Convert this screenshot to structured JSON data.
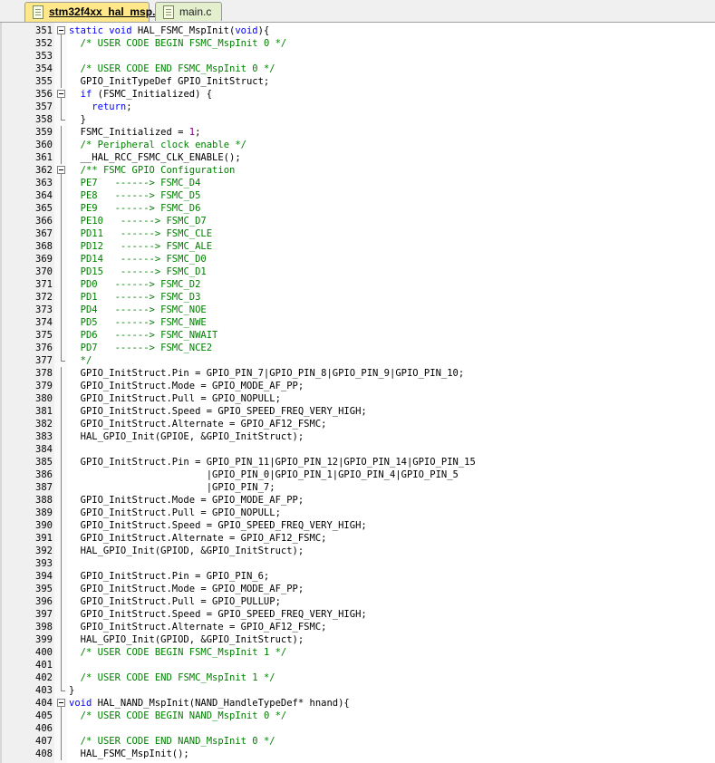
{
  "tabs": [
    {
      "label": "stm32f4xx_hal_msp.c",
      "active": true
    },
    {
      "label": "main.c",
      "active": false
    }
  ],
  "editor": {
    "lines": [
      {
        "n": "351",
        "fold": "start",
        "segs": [
          [
            "kw",
            "static void "
          ],
          [
            "",
            "HAL_FSMC_MspInit("
          ],
          [
            "kw",
            "void"
          ],
          [
            "",
            "){"
          ]
        ]
      },
      {
        "n": "352",
        "fold": "line",
        "segs": [
          [
            "",
            "  "
          ],
          [
            "cm",
            "/* USER CODE BEGIN FSMC_MspInit 0 */"
          ]
        ]
      },
      {
        "n": "353",
        "fold": "line",
        "segs": []
      },
      {
        "n": "354",
        "fold": "line",
        "segs": [
          [
            "",
            "  "
          ],
          [
            "cm",
            "/* USER CODE END FSMC_MspInit 0 */"
          ]
        ]
      },
      {
        "n": "355",
        "fold": "line",
        "segs": [
          [
            "",
            "  GPIO_InitTypeDef GPIO_InitStruct;"
          ]
        ]
      },
      {
        "n": "356",
        "fold": "start",
        "segs": [
          [
            "",
            "  "
          ],
          [
            "kw",
            "if"
          ],
          [
            "",
            " (FSMC_Initialized) {"
          ]
        ]
      },
      {
        "n": "357",
        "fold": "line",
        "segs": [
          [
            "",
            "    "
          ],
          [
            "kw",
            "return"
          ],
          [
            "",
            ";"
          ]
        ]
      },
      {
        "n": "358",
        "fold": "end",
        "segs": [
          [
            "",
            "  }"
          ]
        ]
      },
      {
        "n": "359",
        "fold": "line",
        "segs": [
          [
            "",
            "  FSMC_Initialized = "
          ],
          [
            "num",
            "1"
          ],
          [
            "",
            ";"
          ]
        ]
      },
      {
        "n": "360",
        "fold": "line",
        "segs": [
          [
            "",
            "  "
          ],
          [
            "cm",
            "/* Peripheral clock enable */"
          ]
        ]
      },
      {
        "n": "361",
        "fold": "line",
        "segs": [
          [
            "",
            "  __HAL_RCC_FSMC_CLK_ENABLE();"
          ]
        ]
      },
      {
        "n": "362",
        "fold": "start",
        "segs": [
          [
            "",
            "  "
          ],
          [
            "cm",
            "/** FSMC GPIO Configuration"
          ]
        ]
      },
      {
        "n": "363",
        "fold": "line",
        "segs": [
          [
            "",
            "  "
          ],
          [
            "cm",
            "PE7   ------> FSMC_D4"
          ]
        ]
      },
      {
        "n": "364",
        "fold": "line",
        "segs": [
          [
            "",
            "  "
          ],
          [
            "cm",
            "PE8   ------> FSMC_D5"
          ]
        ]
      },
      {
        "n": "365",
        "fold": "line",
        "segs": [
          [
            "",
            "  "
          ],
          [
            "cm",
            "PE9   ------> FSMC_D6"
          ]
        ]
      },
      {
        "n": "366",
        "fold": "line",
        "segs": [
          [
            "",
            "  "
          ],
          [
            "cm",
            "PE10   ------> FSMC_D7"
          ]
        ]
      },
      {
        "n": "367",
        "fold": "line",
        "segs": [
          [
            "",
            "  "
          ],
          [
            "cm",
            "PD11   ------> FSMC_CLE"
          ]
        ]
      },
      {
        "n": "368",
        "fold": "line",
        "segs": [
          [
            "",
            "  "
          ],
          [
            "cm",
            "PD12   ------> FSMC_ALE"
          ]
        ]
      },
      {
        "n": "369",
        "fold": "line",
        "segs": [
          [
            "",
            "  "
          ],
          [
            "cm",
            "PD14   ------> FSMC_D0"
          ]
        ]
      },
      {
        "n": "370",
        "fold": "line",
        "segs": [
          [
            "",
            "  "
          ],
          [
            "cm",
            "PD15   ------> FSMC_D1"
          ]
        ]
      },
      {
        "n": "371",
        "fold": "line",
        "segs": [
          [
            "",
            "  "
          ],
          [
            "cm",
            "PD0   ------> FSMC_D2"
          ]
        ]
      },
      {
        "n": "372",
        "fold": "line",
        "segs": [
          [
            "",
            "  "
          ],
          [
            "cm",
            "PD1   ------> FSMC_D3"
          ]
        ]
      },
      {
        "n": "373",
        "fold": "line",
        "segs": [
          [
            "",
            "  "
          ],
          [
            "cm",
            "PD4   ------> FSMC_NOE"
          ]
        ]
      },
      {
        "n": "374",
        "fold": "line",
        "segs": [
          [
            "",
            "  "
          ],
          [
            "cm",
            "PD5   ------> FSMC_NWE"
          ]
        ]
      },
      {
        "n": "375",
        "fold": "line",
        "segs": [
          [
            "",
            "  "
          ],
          [
            "cm",
            "PD6   ------> FSMC_NWAIT"
          ]
        ]
      },
      {
        "n": "376",
        "fold": "line",
        "segs": [
          [
            "",
            "  "
          ],
          [
            "cm",
            "PD7   ------> FSMC_NCE2"
          ]
        ]
      },
      {
        "n": "377",
        "fold": "end",
        "segs": [
          [
            "",
            "  "
          ],
          [
            "cm",
            "*/"
          ]
        ]
      },
      {
        "n": "378",
        "fold": "line",
        "segs": [
          [
            "",
            "  GPIO_InitStruct.Pin = GPIO_PIN_7|GPIO_PIN_8|GPIO_PIN_9|GPIO_PIN_10;"
          ]
        ]
      },
      {
        "n": "379",
        "fold": "line",
        "segs": [
          [
            "",
            "  GPIO_InitStruct.Mode = GPIO_MODE_AF_PP;"
          ]
        ]
      },
      {
        "n": "380",
        "fold": "line",
        "segs": [
          [
            "",
            "  GPIO_InitStruct.Pull = GPIO_NOPULL;"
          ]
        ]
      },
      {
        "n": "381",
        "fold": "line",
        "segs": [
          [
            "",
            "  GPIO_InitStruct.Speed = GPIO_SPEED_FREQ_VERY_HIGH;"
          ]
        ]
      },
      {
        "n": "382",
        "fold": "line",
        "segs": [
          [
            "",
            "  GPIO_InitStruct.Alternate = GPIO_AF12_FSMC;"
          ]
        ]
      },
      {
        "n": "383",
        "fold": "line",
        "segs": [
          [
            "",
            "  HAL_GPIO_Init(GPIOE, &GPIO_InitStruct);"
          ]
        ]
      },
      {
        "n": "384",
        "fold": "line",
        "segs": []
      },
      {
        "n": "385",
        "fold": "line",
        "segs": [
          [
            "",
            "  GPIO_InitStruct.Pin = GPIO_PIN_11|GPIO_PIN_12|GPIO_PIN_14|GPIO_PIN_15"
          ]
        ]
      },
      {
        "n": "386",
        "fold": "line",
        "segs": [
          [
            "",
            "                        |GPIO_PIN_0|GPIO_PIN_1|GPIO_PIN_4|GPIO_PIN_5"
          ]
        ]
      },
      {
        "n": "387",
        "fold": "line",
        "segs": [
          [
            "",
            "                        |GPIO_PIN_7;"
          ]
        ]
      },
      {
        "n": "388",
        "fold": "line",
        "segs": [
          [
            "",
            "  GPIO_InitStruct.Mode = GPIO_MODE_AF_PP;"
          ]
        ]
      },
      {
        "n": "389",
        "fold": "line",
        "segs": [
          [
            "",
            "  GPIO_InitStruct.Pull = GPIO_NOPULL;"
          ]
        ]
      },
      {
        "n": "390",
        "fold": "line",
        "segs": [
          [
            "",
            "  GPIO_InitStruct.Speed = GPIO_SPEED_FREQ_VERY_HIGH;"
          ]
        ]
      },
      {
        "n": "391",
        "fold": "line",
        "segs": [
          [
            "",
            "  GPIO_InitStruct.Alternate = GPIO_AF12_FSMC;"
          ]
        ]
      },
      {
        "n": "392",
        "fold": "line",
        "segs": [
          [
            "",
            "  HAL_GPIO_Init(GPIOD, &GPIO_InitStruct);"
          ]
        ]
      },
      {
        "n": "393",
        "fold": "line",
        "segs": []
      },
      {
        "n": "394",
        "fold": "line",
        "segs": [
          [
            "",
            "  GPIO_InitStruct.Pin = GPIO_PIN_6;"
          ]
        ]
      },
      {
        "n": "395",
        "fold": "line",
        "segs": [
          [
            "",
            "  GPIO_InitStruct.Mode = GPIO_MODE_AF_PP;"
          ]
        ]
      },
      {
        "n": "396",
        "fold": "line",
        "segs": [
          [
            "",
            "  GPIO_InitStruct.Pull = GPIO_PULLUP;"
          ]
        ]
      },
      {
        "n": "397",
        "fold": "line",
        "segs": [
          [
            "",
            "  GPIO_InitStruct.Speed = GPIO_SPEED_FREQ_VERY_HIGH;"
          ]
        ]
      },
      {
        "n": "398",
        "fold": "line",
        "segs": [
          [
            "",
            "  GPIO_InitStruct.Alternate = GPIO_AF12_FSMC;"
          ]
        ]
      },
      {
        "n": "399",
        "fold": "line",
        "segs": [
          [
            "",
            "  HAL_GPIO_Init(GPIOD, &GPIO_InitStruct);"
          ]
        ]
      },
      {
        "n": "400",
        "fold": "line",
        "segs": [
          [
            "",
            "  "
          ],
          [
            "cm",
            "/* USER CODE BEGIN FSMC_MspInit 1 */"
          ]
        ]
      },
      {
        "n": "401",
        "fold": "line",
        "segs": []
      },
      {
        "n": "402",
        "fold": "line",
        "segs": [
          [
            "",
            "  "
          ],
          [
            "cm",
            "/* USER CODE END FSMC_MspInit 1 */"
          ]
        ]
      },
      {
        "n": "403",
        "fold": "end",
        "segs": [
          [
            "",
            "}"
          ]
        ]
      },
      {
        "n": "404",
        "fold": "start",
        "segs": [
          [
            "kw",
            "void "
          ],
          [
            "",
            "HAL_NAND_MspInit(NAND_HandleTypeDef* hnand){"
          ]
        ]
      },
      {
        "n": "405",
        "fold": "line",
        "segs": [
          [
            "",
            "  "
          ],
          [
            "cm",
            "/* USER CODE BEGIN NAND_MspInit 0 */"
          ]
        ]
      },
      {
        "n": "406",
        "fold": "line",
        "segs": []
      },
      {
        "n": "407",
        "fold": "line",
        "segs": [
          [
            "",
            "  "
          ],
          [
            "cm",
            "/* USER CODE END NAND_MspInit 0 */"
          ]
        ]
      },
      {
        "n": "408",
        "fold": "line",
        "segs": [
          [
            "",
            "  HAL_FSMC_MspInit();"
          ]
        ]
      }
    ]
  }
}
